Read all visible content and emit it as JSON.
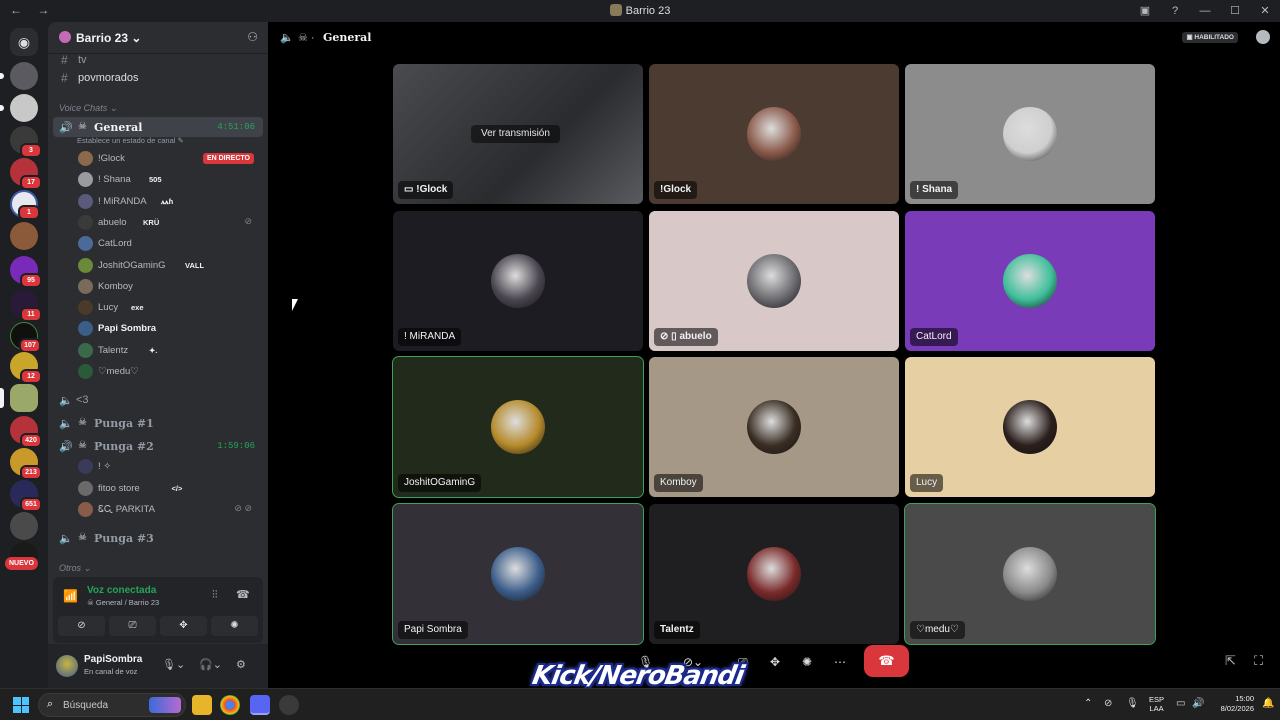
{
  "window": {
    "title": "Barrio 23"
  },
  "server": {
    "name": "Barrio 23"
  },
  "rail": {
    "badges": [
      "3",
      "17",
      "1",
      "95",
      "11",
      "107",
      "12",
      "420",
      "213",
      "651"
    ],
    "new_label": "NUEVO"
  },
  "channels": {
    "text": [
      "tv",
      "povmorados"
    ],
    "voice_category": "Voice Chats",
    "other_category": "Otros",
    "general": {
      "name": "General",
      "time": "4:51:06",
      "status": "Establece un estado de canal"
    },
    "heart": {
      "name": "<3"
    },
    "punga1": {
      "name": "Punga #1"
    },
    "punga2": {
      "name": "Punga #2",
      "time": "1:59:06"
    },
    "punga3": {
      "name": "Punga #3"
    }
  },
  "general_users": [
    {
      "name": "!Glock",
      "live": "EN DIRECTO"
    },
    {
      "name": "! Shana",
      "tag": "505"
    },
    {
      "name": "! MiRANDA",
      "tag": "ꭺꭺɦ"
    },
    {
      "name": "abuelo",
      "tag": "KRÜ"
    },
    {
      "name": "CatLord"
    },
    {
      "name": "JoshitOGaminG",
      "tag": "VALL"
    },
    {
      "name": "Komboy"
    },
    {
      "name": "Lucy",
      "tag": "exe"
    },
    {
      "name": "Papi Sombra"
    },
    {
      "name": "Talentz",
      "tag": "✦."
    },
    {
      "name": "♡medu♡"
    }
  ],
  "punga2_users": [
    {
      "name": "! ✧"
    },
    {
      "name": "fitoo store",
      "tag": "</>"
    },
    {
      "name": "ᏋᏩ PARKITA"
    }
  ],
  "voice_panel": {
    "status": "Voz conectada",
    "location": "General / Barrio 23"
  },
  "user": {
    "name": "PapiSombra",
    "status": "En canal de voz"
  },
  "main": {
    "channel_title": "General",
    "habilitado": "HABILITADO",
    "stream_label": "Ver transmisión"
  },
  "tiles": [
    {
      "name": "!Glock",
      "bg": "#3a3b3e",
      "pic": "#a14a7a"
    },
    {
      "name": "!Glock",
      "bg": "#4b3b30",
      "pic": "#8a5a4a"
    },
    {
      "name": "! Shana",
      "bg": "#8c8c8c",
      "pic": "#cfcfcf"
    },
    {
      "name": "! MiRANDA",
      "bg": "#1d1c22",
      "pic": "#4a4550"
    },
    {
      "name": "abuelo",
      "bg": "#d9c8c8",
      "pic": "#6b6b70"
    },
    {
      "name": "CatLord",
      "bg": "#7a3bb8",
      "pic": "#3fbf9a"
    },
    {
      "name": "JoshitOGaminG",
      "bg": "#222a1c",
      "pic": "#b58a2a"
    },
    {
      "name": "Komboy",
      "bg": "#a69886",
      "pic": "#3a2e24"
    },
    {
      "name": "Lucy",
      "bg": "#e5cfa3",
      "pic": "#2b1f1c"
    },
    {
      "name": "Papi Sombra",
      "bg": "#333137",
      "pic": "#3b5d8a"
    },
    {
      "name": "Talentz",
      "bg": "#1f1f21",
      "pic": "#7a2a2a"
    },
    {
      "name": "♡medu♡",
      "bg": "#4a4a4a",
      "pic": "#8a8a8a"
    }
  ],
  "watermark": "Kick/NeroBandi",
  "taskbar": {
    "search": "Búsqueda",
    "lang_top": "ESP",
    "lang_bottom": "LAA",
    "time": "15:00",
    "date": "8/02/2026"
  }
}
